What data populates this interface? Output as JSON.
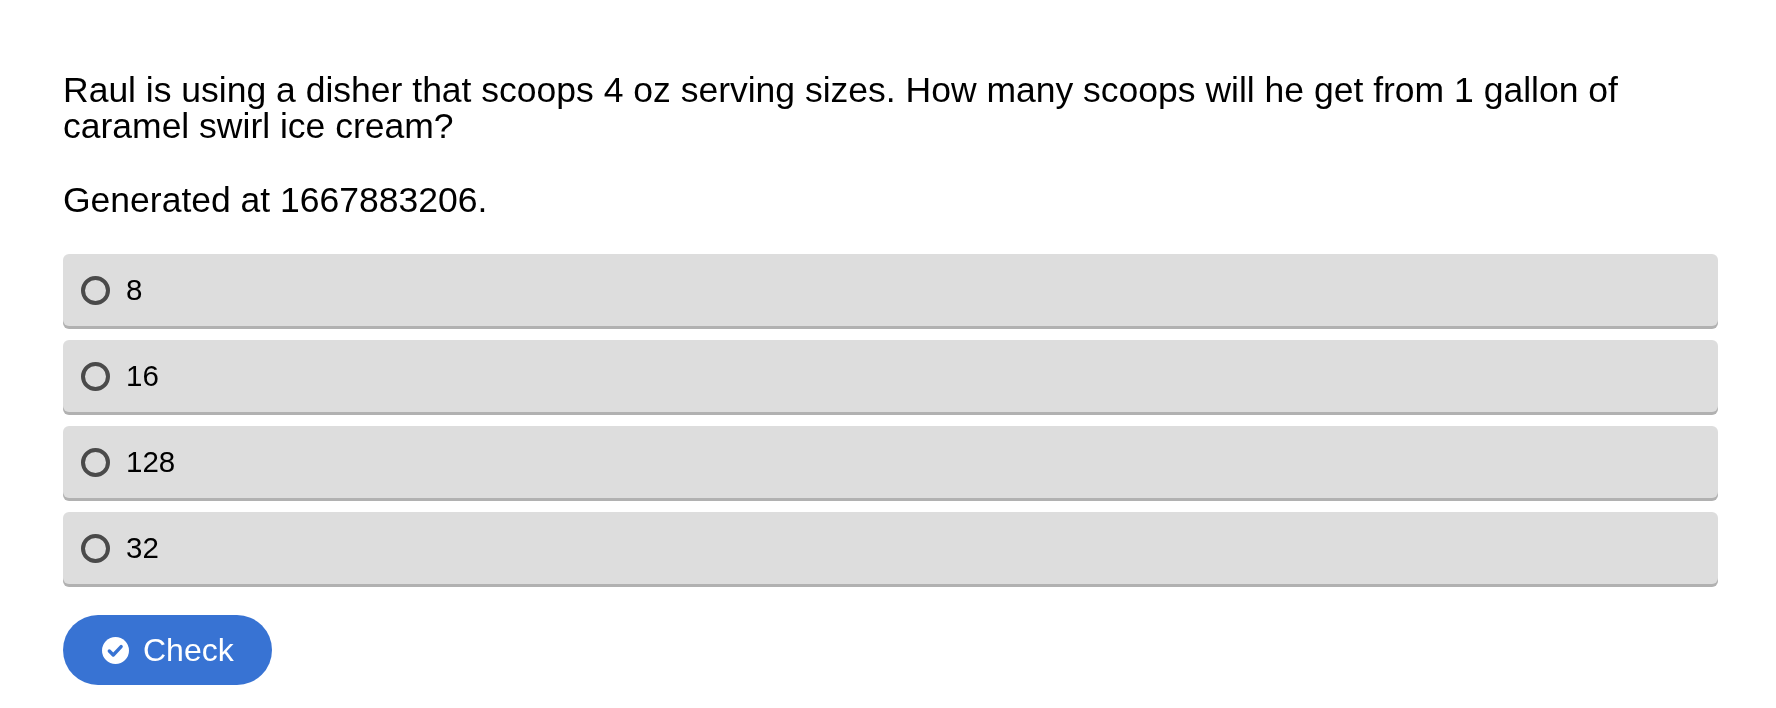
{
  "question": "Raul is using a disher that scoops 4 oz serving sizes. How many scoops will he get from 1 gallon of caramel swirl ice cream?",
  "generated": "Generated at 1667883206.",
  "options": [
    {
      "label": "8",
      "selected": false
    },
    {
      "label": "16",
      "selected": false
    },
    {
      "label": "128",
      "selected": false
    },
    {
      "label": "32",
      "selected": false
    }
  ],
  "button": {
    "label": "Check"
  }
}
